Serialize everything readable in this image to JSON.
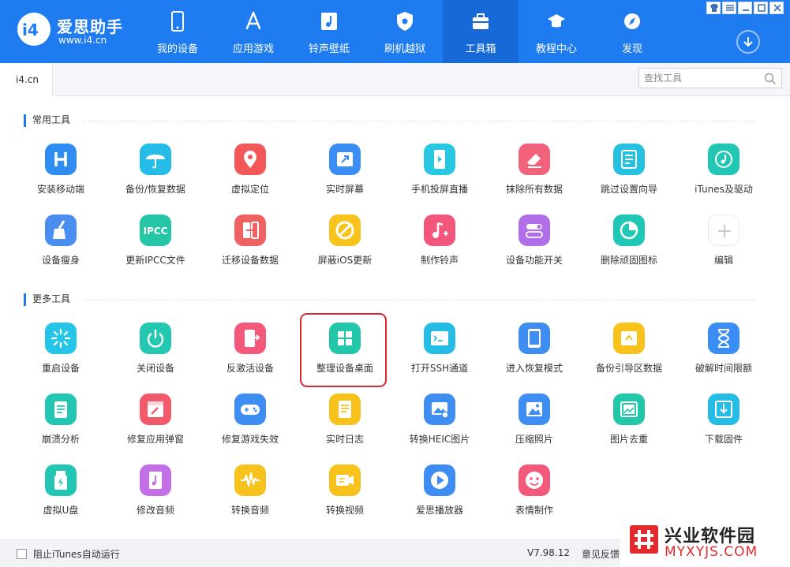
{
  "brand": {
    "name": "爱思助手",
    "url": "www.i4.cn",
    "color": "#1e7cf0"
  },
  "nav": {
    "items": [
      {
        "label": "我的设备",
        "icon": "phone-icon"
      },
      {
        "label": "应用游戏",
        "icon": "app-store-icon"
      },
      {
        "label": "铃声壁纸",
        "icon": "music-note-icon"
      },
      {
        "label": "刷机越狱",
        "icon": "shield-icon"
      },
      {
        "label": "工具箱",
        "icon": "toolbox-icon",
        "active": true
      },
      {
        "label": "教程中心",
        "icon": "graduation-cap-icon"
      },
      {
        "label": "发现",
        "icon": "compass-icon"
      }
    ]
  },
  "tabbar": {
    "tab_label": "i4.cn",
    "search_placeholder": "查找工具"
  },
  "sections": {
    "common": {
      "title": "常用工具"
    },
    "more": {
      "title": "更多工具"
    }
  },
  "tools": {
    "common": [
      {
        "label": "安装移动端",
        "icon": "i4-logo-icon",
        "color": "#2f8cf0"
      },
      {
        "label": "备份/恢复数据",
        "icon": "umbrella-icon",
        "color": "#25bde8"
      },
      {
        "label": "虚拟定位",
        "icon": "location-pin-icon",
        "color": "#f25858"
      },
      {
        "label": "实时屏幕",
        "icon": "screen-share-icon",
        "color": "#3a8ef5"
      },
      {
        "label": "手机投屏直播",
        "icon": "phone-play-icon",
        "color": "#2ac7e3"
      },
      {
        "label": "抹除所有数据",
        "icon": "eraser-icon",
        "color": "#f2627a"
      },
      {
        "label": "跳过设置向导",
        "icon": "settings-list-icon",
        "color": "#26c1e0"
      },
      {
        "label": "iTunes及驱动",
        "icon": "itunes-icon",
        "color": "#21c7b4"
      },
      {
        "label": "设备瘦身",
        "icon": "broom-icon",
        "color": "#4a8ef2"
      },
      {
        "label": "更新IPCC文件",
        "icon": "ipcc-icon",
        "color": "#25c6a6"
      },
      {
        "label": "迁移设备数据",
        "icon": "migrate-icon",
        "color": "#f06262"
      },
      {
        "label": "屏蔽iOS更新",
        "icon": "block-update-icon",
        "color": "#f7c31c"
      },
      {
        "label": "制作铃声",
        "icon": "ringtone-icon",
        "color": "#f2567a"
      },
      {
        "label": "设备功能开关",
        "icon": "toggle-icon",
        "color": "#b06ee8"
      },
      {
        "label": "删除顽固图标",
        "icon": "pie-icon",
        "color": "#20c7b4"
      },
      {
        "label": "编辑",
        "icon": "plus-icon",
        "color": "#d0d4da"
      }
    ],
    "more": [
      {
        "label": "重启设备",
        "icon": "restart-icon",
        "color": "#26c4e6"
      },
      {
        "label": "关闭设备",
        "icon": "power-icon",
        "color": "#24c7b0"
      },
      {
        "label": "反激活设备",
        "icon": "deactivate-icon",
        "color": "#f2597a"
      },
      {
        "label": "整理设备桌面",
        "icon": "grid-icon",
        "color": "#22c6a8"
      },
      {
        "label": "打开SSH通道",
        "icon": "terminal-icon",
        "color": "#25bde6"
      },
      {
        "label": "进入恢复模式",
        "icon": "tablet-icon",
        "color": "#3d8df2"
      },
      {
        "label": "备份引导区数据",
        "icon": "drive-icon",
        "color": "#f7c21b"
      },
      {
        "label": "破解时间限额",
        "icon": "hourglass-icon",
        "color": "#3a8ef5"
      },
      {
        "label": "崩溃分析",
        "icon": "clipboard-icon",
        "color": "#23c6b2"
      },
      {
        "label": "修复应用弹窗",
        "icon": "repair-window-icon",
        "color": "#f25a6c"
      },
      {
        "label": "修复游戏失效",
        "icon": "gamepad-icon",
        "color": "#3d8df2"
      },
      {
        "label": "实时日志",
        "icon": "document-icon",
        "color": "#f7c21b"
      },
      {
        "label": "转换HEIC图片",
        "icon": "image-convert-icon",
        "color": "#3d8df2"
      },
      {
        "label": "压缩照片",
        "icon": "image-icon",
        "color": "#3d8df2"
      },
      {
        "label": "图片去重",
        "icon": "image-dedupe-icon",
        "color": "#22c6a8"
      },
      {
        "label": "下载固件",
        "icon": "firmware-download-icon",
        "color": "#25bde6"
      },
      {
        "label": "虚拟U盘",
        "icon": "usb-drive-icon",
        "color": "#23c6b2"
      },
      {
        "label": "修改音频",
        "icon": "audio-file-icon",
        "color": "#c26fe8"
      },
      {
        "label": "转换音频",
        "icon": "waveform-icon",
        "color": "#f7c21b"
      },
      {
        "label": "转换视频",
        "icon": "video-convert-icon",
        "color": "#f7c21b"
      },
      {
        "label": "爱思播放器",
        "icon": "play-icon",
        "color": "#3d8df2"
      },
      {
        "label": "表情制作",
        "icon": "emoji-icon",
        "color": "#f2597a"
      }
    ]
  },
  "footer": {
    "checkbox_label": "阻止iTunes自动运行",
    "checkbox_checked": false,
    "version": "V7.98.12",
    "feedback_label": "意见反馈"
  },
  "watermark": {
    "title": "兴业软件园",
    "subtitle": "MYXYJS.COM"
  }
}
